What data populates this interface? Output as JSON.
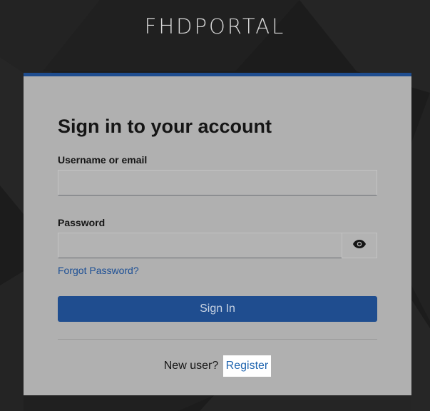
{
  "brand": {
    "name": "FHDPORTAL"
  },
  "login": {
    "title": "Sign in to your account",
    "username_label": "Username or email",
    "username_value": "",
    "password_label": "Password",
    "password_value": "",
    "toggle_icon": "eye-icon",
    "forgot_link": "Forgot Password?",
    "submit_label": "Sign In",
    "new_user_text": "New user?",
    "register_link": "Register"
  },
  "colors": {
    "background": "#1d1d1d",
    "card": "#b0b0b0",
    "accent": "#1f4d8f",
    "link": "#1c4f95"
  }
}
